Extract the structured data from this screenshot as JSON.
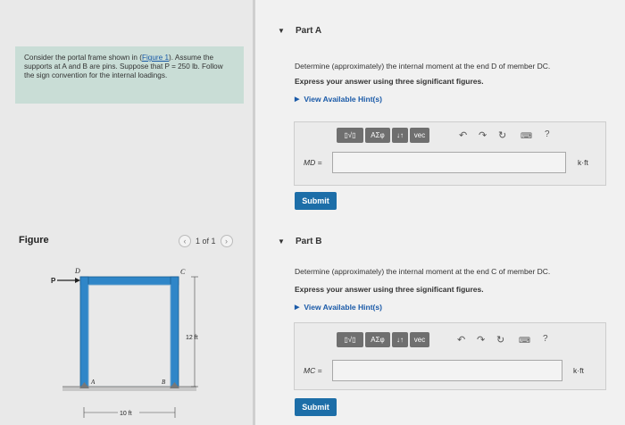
{
  "problem": {
    "text_before": "Consider the portal frame shown in (",
    "figure_link": "Figure 1",
    "text_after": "). Assume the supports at A and B are pins. Suppose that P = 250 lb. Follow the sign convention for the internal loadings."
  },
  "figure_panel": {
    "title": "Figure",
    "page_text": "1 of 1",
    "prev_icon": "chevron-left-icon",
    "next_icon": "chevron-right-icon",
    "labels": {
      "p": "P",
      "d": "D",
      "c": "C",
      "a": "A",
      "b": "B",
      "height": "12 ft",
      "width": "10 ft"
    },
    "frame_color": "#2f86c8"
  },
  "part_a": {
    "title": "Part A",
    "question": "Determine (approximately) the internal moment at the end D of member DC.",
    "instruction": "Express your answer using three significant figures.",
    "hint": "View Available Hint(s)",
    "answer_label": "MD =",
    "answer_value": "",
    "unit": "k·ft",
    "submit": "Submit"
  },
  "part_b": {
    "title": "Part B",
    "question": "Determine (approximately) the internal moment at the end C of member DC.",
    "instruction": "Express your answer using three significant figures.",
    "hint": "View Available Hint(s)",
    "answer_label": "MC =",
    "answer_value": "",
    "unit": "k·ft",
    "submit": "Submit"
  },
  "toolbar": {
    "template_button": "▯√▯",
    "greek_button": "ΑΣφ",
    "sort_button": "↓↑",
    "vec_button": "vec",
    "undo_icon": "undo-icon",
    "redo_icon": "redo-icon",
    "reset_icon": "reset-icon",
    "keyboard_icon": "keyboard-icon",
    "help_button": "?"
  },
  "colors": {
    "accent": "#1d6ea8",
    "problem_bg": "#c9ddd6",
    "link": "#1a5aa8"
  }
}
